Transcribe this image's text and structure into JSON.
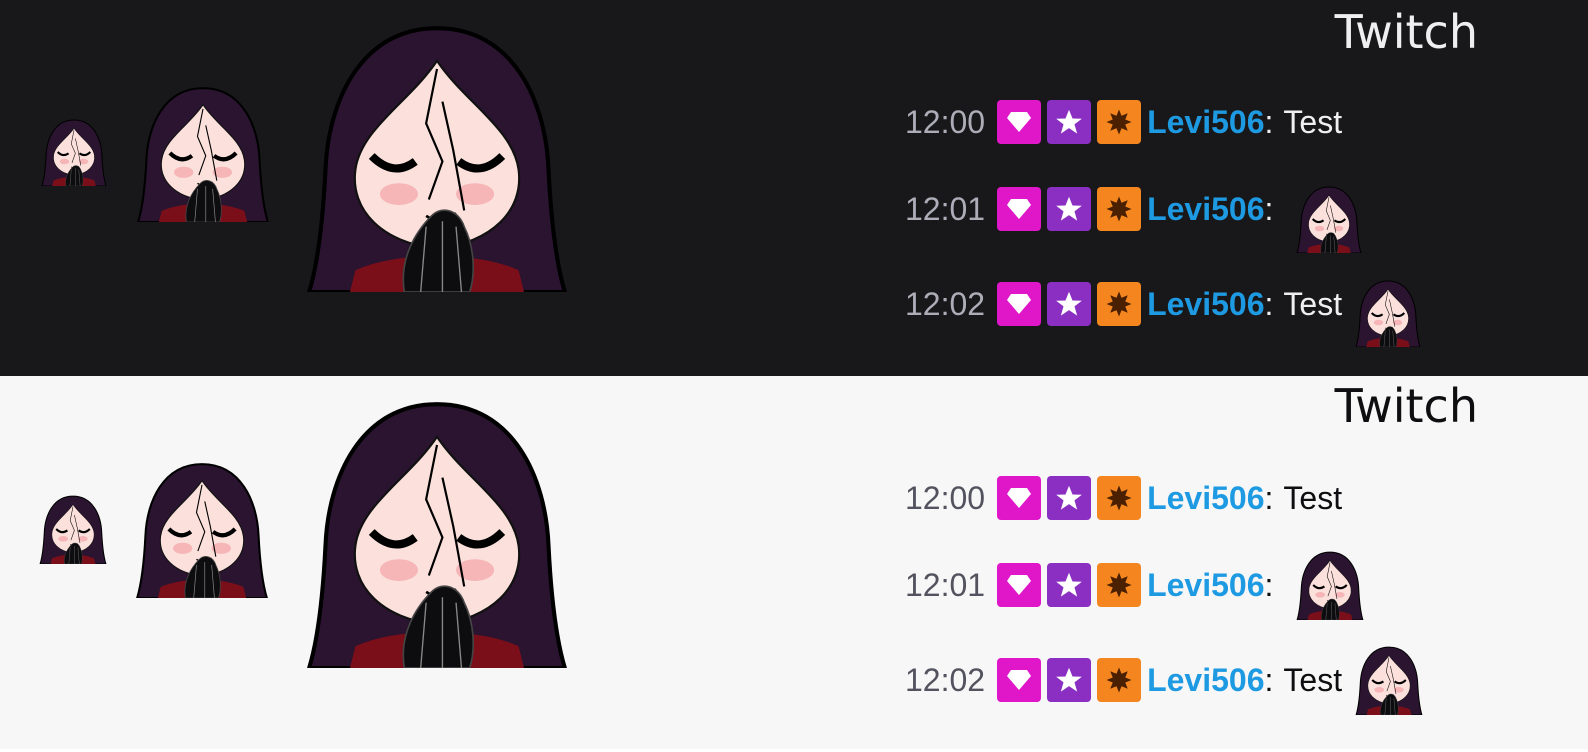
{
  "panels": [
    {
      "theme": "dark",
      "title": "Twitch",
      "messages": [
        {
          "time": "12:00",
          "user": "Levi506",
          "colon": ":",
          "text": "Test"
        },
        {
          "time": "12:01",
          "user": "Levi506",
          "colon": ":",
          "text": ""
        },
        {
          "time": "12:02",
          "user": "Levi506",
          "colon": ":",
          "text": "Test"
        }
      ]
    },
    {
      "theme": "light",
      "title": "Twitch",
      "messages": [
        {
          "time": "12:00",
          "user": "Levi506",
          "colon": ":",
          "text": "Test"
        },
        {
          "time": "12:01",
          "user": "Levi506",
          "colon": ":",
          "text": ""
        },
        {
          "time": "12:02",
          "user": "Levi506",
          "colon": ":",
          "text": "Test"
        }
      ]
    }
  ],
  "badges": [
    {
      "name": "diamond-badge-icon",
      "color": "#e016c9"
    },
    {
      "name": "star-badge-icon",
      "color": "#8a2fc1"
    },
    {
      "name": "starburst-badge-icon",
      "color": "#f5861f"
    }
  ],
  "colors": {
    "username": "#1e9ae2",
    "dark_bg": "#18181b",
    "light_bg": "#f7f7f8"
  }
}
